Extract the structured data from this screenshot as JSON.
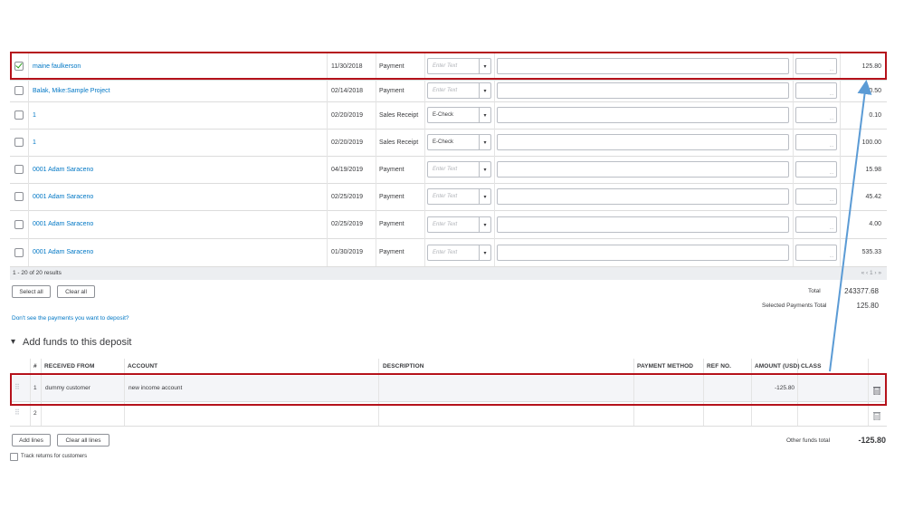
{
  "payments": {
    "rows": [
      {
        "checked": true,
        "name": "maine faulkerson",
        "date": "11/30/2018",
        "type": "Payment",
        "method": "Enter Text",
        "method_placeholder": true,
        "amount": "125.80"
      },
      {
        "checked": false,
        "name": "Balak, Mike:Sample Project",
        "date": "02/14/2018",
        "type": "Payment",
        "method": "Enter Text",
        "method_placeholder": true,
        "amount": "0.50"
      },
      {
        "checked": false,
        "name": "1",
        "date": "02/20/2019",
        "type": "Sales Receipt",
        "method": "E-Check",
        "method_placeholder": false,
        "amount": "0.10"
      },
      {
        "checked": false,
        "name": "1",
        "date": "02/20/2019",
        "type": "Sales Receipt",
        "method": "E-Check",
        "method_placeholder": false,
        "amount": "100.00"
      },
      {
        "checked": false,
        "name": "0001 Adam Saraceno",
        "date": "04/19/2019",
        "type": "Payment",
        "method": "Enter Text",
        "method_placeholder": true,
        "amount": "15.98"
      },
      {
        "checked": false,
        "name": "0001 Adam Saraceno",
        "date": "02/25/2019",
        "type": "Payment",
        "method": "Enter Text",
        "method_placeholder": true,
        "amount": "45.42"
      },
      {
        "checked": false,
        "name": "0001 Adam Saraceno",
        "date": "02/25/2019",
        "type": "Payment",
        "method": "Enter Text",
        "method_placeholder": true,
        "amount": "4.00"
      },
      {
        "checked": false,
        "name": "0001 Adam Saraceno",
        "date": "01/30/2019",
        "type": "Payment",
        "method": "Enter Text",
        "method_placeholder": true,
        "amount": "535.33"
      }
    ],
    "results_text": "1 - 20 of 20 results",
    "pager_text": "« ‹ 1 › »",
    "select_all_label": "Select all",
    "clear_all_label": "Clear all",
    "total_label": "Total",
    "total_value": "243377.68",
    "selected_total_label": "Selected Payments Total",
    "selected_total_value": "125.80",
    "dont_see_link": "Don't see the payments you want to deposit?"
  },
  "add_funds": {
    "section_title": "Add funds to this deposit",
    "toggle_icon": "▾",
    "headers": {
      "num": "#",
      "received_from": "RECEIVED FROM",
      "account": "ACCOUNT",
      "description": "DESCRIPTION",
      "payment_method": "PAYMENT METHOD",
      "ref_no": "REF NO.",
      "amount": "AMOUNT (USD)",
      "class": "CLASS"
    },
    "lines": [
      {
        "num": "1",
        "received_from": "dummy customer",
        "account": "new income account",
        "description": "",
        "payment_method": "",
        "ref_no": "",
        "amount": "-125.80",
        "class": ""
      },
      {
        "num": "2",
        "received_from": "",
        "account": "",
        "description": "",
        "payment_method": "",
        "ref_no": "",
        "amount": "",
        "class": ""
      }
    ],
    "add_lines_label": "Add lines",
    "clear_all_lines_label": "Clear all lines",
    "other_funds_label": "Other funds total",
    "other_funds_value": "-125.80",
    "track_returns_label": "Track returns for customers",
    "drag_icon": "⠿",
    "trash_icon": "🗑"
  },
  "annotation": {
    "box_color": "#b5121b",
    "arrow_color": "#5b9bd5"
  }
}
